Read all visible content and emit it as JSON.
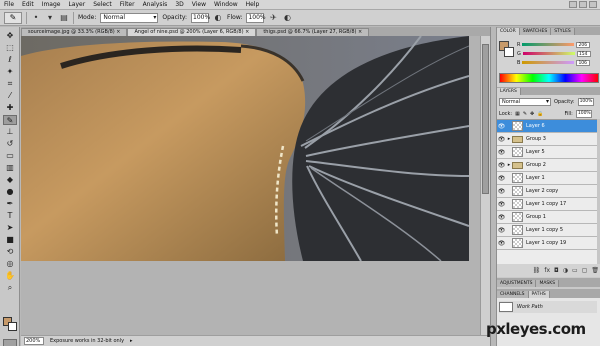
{
  "menu": [
    "File",
    "Edit",
    "Image",
    "Layer",
    "Select",
    "Filter",
    "Analysis",
    "3D",
    "View",
    "Window",
    "Help"
  ],
  "options": {
    "mode_label": "Mode:",
    "mode_value": "Normal",
    "opacity_label": "Opacity:",
    "opacity_value": "100%",
    "flow_label": "Flow:",
    "flow_value": "100%"
  },
  "tabs": [
    "sourceimage.jpg @ 33.3% (RGB/8) ×",
    "Angel of nine.psd @ 200% (Layer 6, RGB/8) ×",
    "thigs.psd @ 66.7% (Layer 27, RGB/8) ×"
  ],
  "statusbar": {
    "zoom": "200%",
    "message": "Exposure works in 32-bit only"
  },
  "color_panel": {
    "tabs": [
      "COLOR",
      "SWATCHES",
      "STYLES"
    ],
    "fg_color": "#c79a6a",
    "r": "206",
    "g": "154",
    "b": "106"
  },
  "layers_panel": {
    "tab": "LAYERS",
    "blend_mode": "Normal",
    "opacity_label": "Opacity:",
    "opacity_value": "100%",
    "lock_label": "Lock:",
    "fill_label": "Fill:",
    "fill_value": "100%",
    "selected_color": "#3d8ddb",
    "layers": [
      {
        "name": "Layer 6",
        "type": "layer",
        "selected": true
      },
      {
        "name": "Group 3",
        "type": "group",
        "selected": false
      },
      {
        "name": "Layer 5",
        "type": "layer",
        "selected": false
      },
      {
        "name": "Group 2",
        "type": "group",
        "selected": false
      },
      {
        "name": "Layer 1",
        "type": "layer",
        "selected": false
      },
      {
        "name": "Layer 2 copy",
        "type": "layer",
        "selected": false
      },
      {
        "name": "Layer 1 copy 17",
        "type": "layer",
        "selected": false
      },
      {
        "name": "Group 1",
        "type": "layer",
        "selected": false
      },
      {
        "name": "Layer 1 copy 5",
        "type": "layer",
        "selected": false
      },
      {
        "name": "Layer 1 copy 19",
        "type": "layer",
        "selected": false
      }
    ]
  },
  "adjust_panel": {
    "tabs": [
      "ADJUSTMENTS",
      "MASKS"
    ]
  },
  "paths_panel": {
    "tabs": [
      "CHANNELS",
      "PATHS"
    ],
    "path_name": "Work Path"
  },
  "watermark": "pxleyes.com"
}
